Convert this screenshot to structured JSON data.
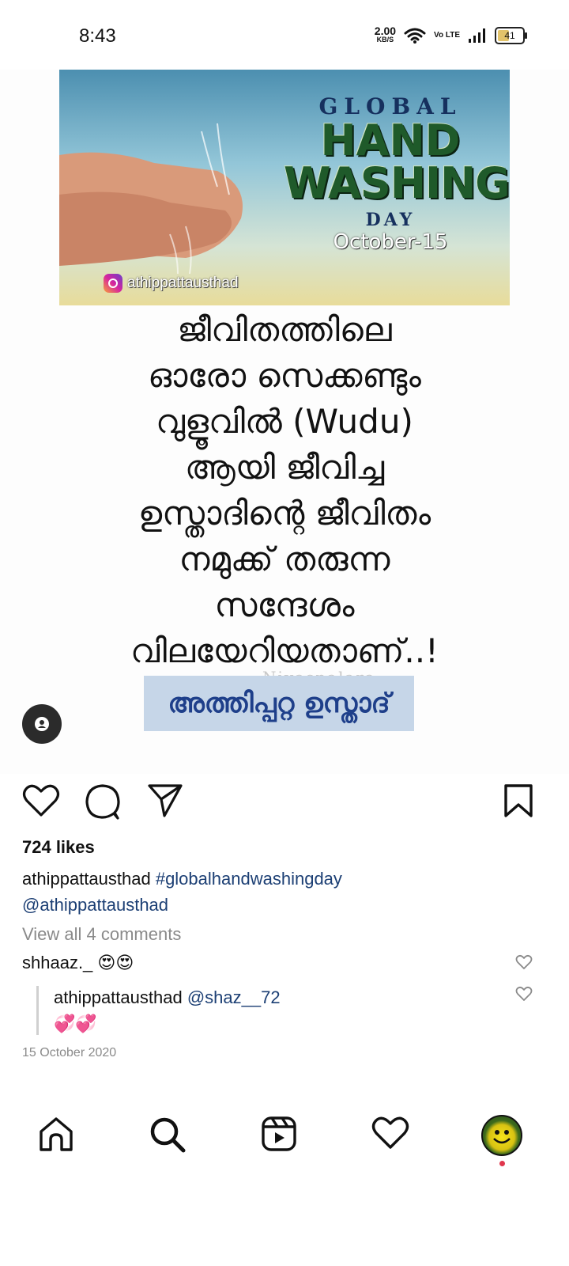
{
  "status": {
    "time": "8:43",
    "speed_value": "2.00",
    "speed_unit": "KB/S",
    "volte": "Vo LTE",
    "battery": "41"
  },
  "post": {
    "banner": {
      "global": "GLOBAL",
      "hand": "HAND",
      "washing": "WASHING",
      "day": "DAY",
      "date": "October-15",
      "handle": "athippattausthad"
    },
    "text_lines": [
      "ജീവിതത്തിലെ",
      "ഓരോ സെക്കണ്ടും",
      "വുളൂവിൽ (Wudu)",
      "ആയി ജീവിച്ച",
      "ഉസ്താദിന്റെ ജീവിതം",
      "നമുക്ക് തരുന്ന",
      "സന്ദേശം",
      "വിലയേറിയതാണ്..!"
    ],
    "watermark": "Niyaspalara",
    "name_box": "അത്തിപ്പറ്റ ഉസ്താദ്"
  },
  "likes": "724 likes",
  "caption": {
    "username": "athippattausthad",
    "hashtag": "#globalhandwashingday",
    "mention": "@athippattausthad"
  },
  "view_all_comments": "View all 4 comments",
  "comment": {
    "username": "shhaaz._",
    "emoji": "😍😍"
  },
  "reply": {
    "username": "athippattausthad",
    "mention": "@shaz__72",
    "emoji": "💞💞"
  },
  "post_date": "15 October 2020",
  "colors": {
    "link": "#1c3f74",
    "muted": "#8a8a8a",
    "name_box_bg": "#c6d6e8",
    "notification_dot": "#e0374d"
  },
  "icons": {
    "actions": [
      "heart-icon",
      "comment-icon",
      "share-icon",
      "bookmark-icon"
    ],
    "nav": [
      "home-icon",
      "search-icon",
      "reels-icon",
      "activity-heart-icon",
      "profile-avatar"
    ]
  }
}
